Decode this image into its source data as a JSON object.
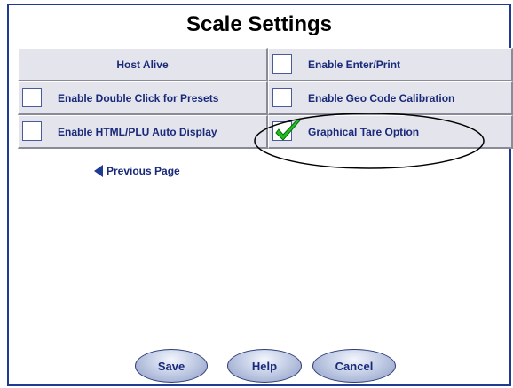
{
  "title": "Scale Settings",
  "buttons": {
    "host_alive": "Host Alive",
    "enable_enter_print": "Enable Enter/Print",
    "enable_double_click": "Enable Double Click for Presets",
    "enable_geo_code": "Enable Geo Code Calibration",
    "enable_html_plu": "Enable HTML/PLU Auto Display",
    "graphical_tare": "Graphical Tare Option"
  },
  "checked": {
    "enable_enter_print": false,
    "enable_double_click": false,
    "enable_geo_code": false,
    "enable_html_plu": false,
    "graphical_tare": true
  },
  "nav": {
    "previous_page": "Previous Page"
  },
  "footer": {
    "save": "Save",
    "help": "Help",
    "cancel": "Cancel"
  },
  "colors": {
    "frame": "#1f3a93",
    "label": "#1a2a7a",
    "button_face": "#e3e4ec",
    "check": "#1fbf1f"
  }
}
